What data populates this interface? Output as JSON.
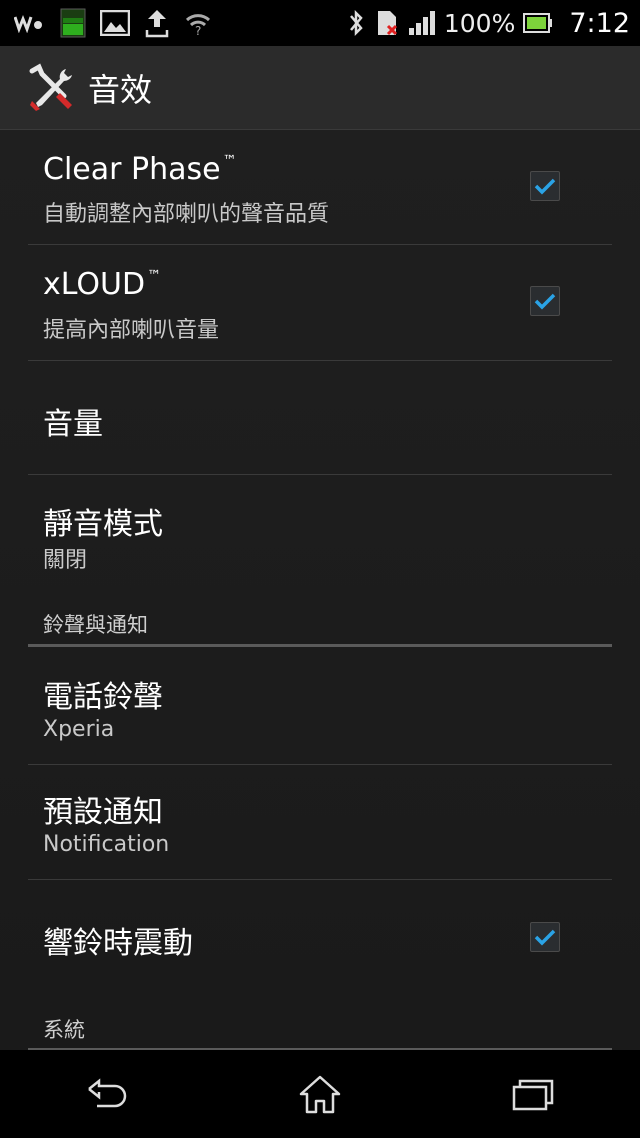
{
  "status_bar": {
    "battery_percent": "100%",
    "time": "7:12",
    "icons": [
      "walkman-icon",
      "battery-widget-icon",
      "gallery-icon",
      "upload-icon",
      "wifi-icon",
      "bluetooth-icon",
      "sim-icon",
      "signal-icon",
      "battery-icon"
    ]
  },
  "action_bar": {
    "title": "音效",
    "icon": "tools-icon"
  },
  "preferences": {
    "clear_phase": {
      "title": "Clear Phase",
      "trademark": "™",
      "summary": "自動調整內部喇叭的聲音品質",
      "checked": true
    },
    "xloud": {
      "title": "xLOUD",
      "trademark": "™",
      "summary": "提高內部喇叭音量",
      "checked": true
    },
    "volume": {
      "title": "音量"
    },
    "silent_mode": {
      "title": "靜音模式",
      "summary": "關閉"
    },
    "ringtone": {
      "title": "電話鈴聲",
      "summary": "Xperia"
    },
    "default_notification": {
      "title": "預設通知",
      "summary": "Notification"
    },
    "vibrate_on_ring": {
      "title": "響鈴時震動",
      "checked": true
    }
  },
  "categories": {
    "ringtone_notifications": "鈴聲與通知",
    "system": "系統"
  },
  "nav_bar": [
    "back-icon",
    "home-icon",
    "recent-apps-icon"
  ],
  "colors": {
    "accent": "#2aa3e6",
    "background": "#1c1c1c",
    "divider": "#3a3a3a"
  }
}
